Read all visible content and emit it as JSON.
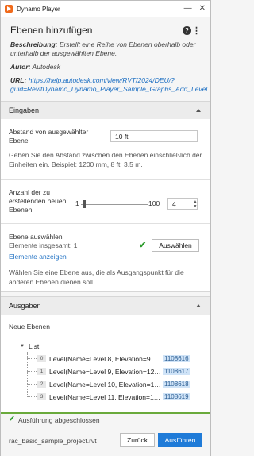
{
  "window": {
    "title": "Dynamo Player",
    "minimize": "—",
    "close": "✕"
  },
  "header": {
    "title": "Ebenen hinzufügen",
    "description_label": "Beschreibung:",
    "description_text": "Erstellt eine Reihe von Ebenen oberhalb oder unterhalb der ausgewählten Ebene.",
    "author_label": "Autor:",
    "author_value": "Autodesk",
    "url_label": "URL:",
    "url_line1": "https://help.autodesk.com/view/RVT/2024/DEU/?",
    "url_line2": "guid=RevitDynamo_Dynamo_Player_Sample_Graphs_Add_Level"
  },
  "inputs": {
    "section_title": "Eingaben",
    "distance_label": "Abstand von ausgewählter Ebene",
    "distance_value": "10 ft",
    "distance_help": "Geben Sie den Abstand zwischen den Ebenen einschließlich der Einheiten ein. Beispiel: 1200 mm, 8 ft, 3.5 m.",
    "count_label": "Anzahl der zu erstellenden neuen Ebenen",
    "slider_min": "1",
    "slider_max": "100",
    "slider_value_fraction": 0.03,
    "count_value": "4",
    "select_label": "Ebene auswählen",
    "elements_total": "Elemente insgesamt: 1",
    "select_button": "Auswählen",
    "show_elements": "Elemente anzeigen",
    "select_help": "Wählen Sie eine Ebene aus, die als Ausgangspunkt für die anderen Ebenen dienen soll."
  },
  "outputs": {
    "section_title": "Ausgaben",
    "output_label": "Neue Ebenen",
    "list_label": "List",
    "items": [
      {
        "index": "0",
        "text": "Level(Name=Level 8, Elevation=9…",
        "id": "1108616"
      },
      {
        "index": "1",
        "text": "Level(Name=Level 9, Elevation=12…",
        "id": "1108617"
      },
      {
        "index": "2",
        "text": "Level(Name=Level 10, Elevation=1…",
        "id": "1108618"
      },
      {
        "index": "3",
        "text": "Level(Name=Level 11, Elevation=1…",
        "id": "1108619"
      }
    ]
  },
  "footer": {
    "status": "Ausführung abgeschlossen",
    "file_name": "rac_basic_sample_project.rvt",
    "back_button": "Zurück",
    "run_button": "Ausführen"
  },
  "colors": {
    "accent": "#1f7bd8",
    "success": "#2e9d2e",
    "id_highlight": "#cfe3f7",
    "status_bar": "#6aaa3c"
  }
}
